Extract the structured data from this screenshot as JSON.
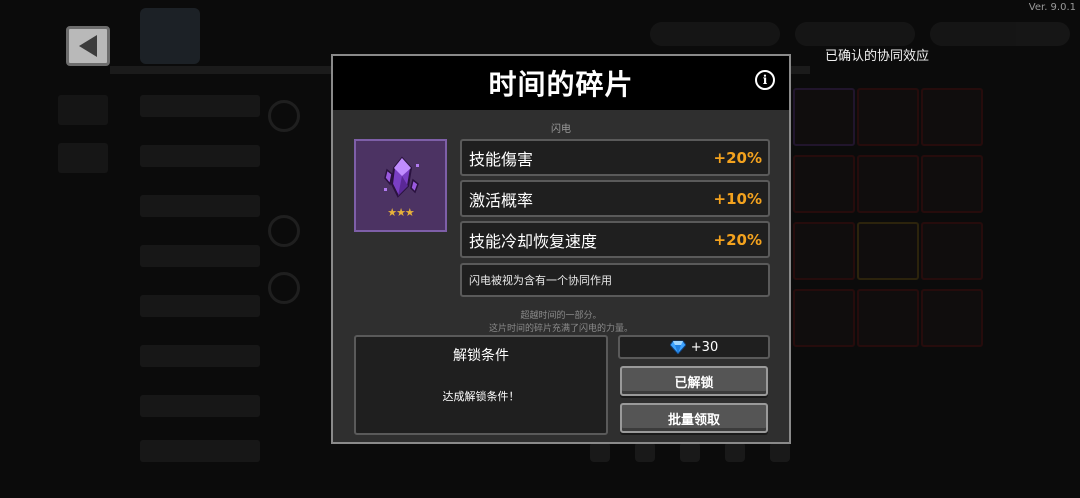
{
  "version": "Ver. 9.0.1",
  "synergy_label": "已确认的协同效应",
  "modal": {
    "title": "时间的碎片",
    "subtitle": "闪电",
    "item": {
      "icon": "purple-crystal-icon",
      "stars": "★★★",
      "star_count": 3
    },
    "stats": [
      {
        "name": "技能傷害",
        "value": "+20%"
      },
      {
        "name": "激活概率",
        "value": "+10%"
      },
      {
        "name": "技能冷却恢复速度",
        "value": "+20%"
      }
    ],
    "description": "闪电被视为含有一个协同作用",
    "flavor": [
      "超越时间的一部分。",
      "这片时间的碎片充满了闪电的力量。"
    ],
    "unlock": {
      "title": "解锁条件",
      "condition": "达成解锁条件！"
    },
    "reward": {
      "icon": "diamond-gem-icon",
      "value": "+30"
    },
    "buttons": {
      "unlocked": "已解锁",
      "batch_claim": "批量领取"
    }
  },
  "colors": {
    "accent": "#f3a21e",
    "item_bg": "#4c3363",
    "item_border": "#7e5fa8",
    "panel": "#2f2f2f"
  }
}
